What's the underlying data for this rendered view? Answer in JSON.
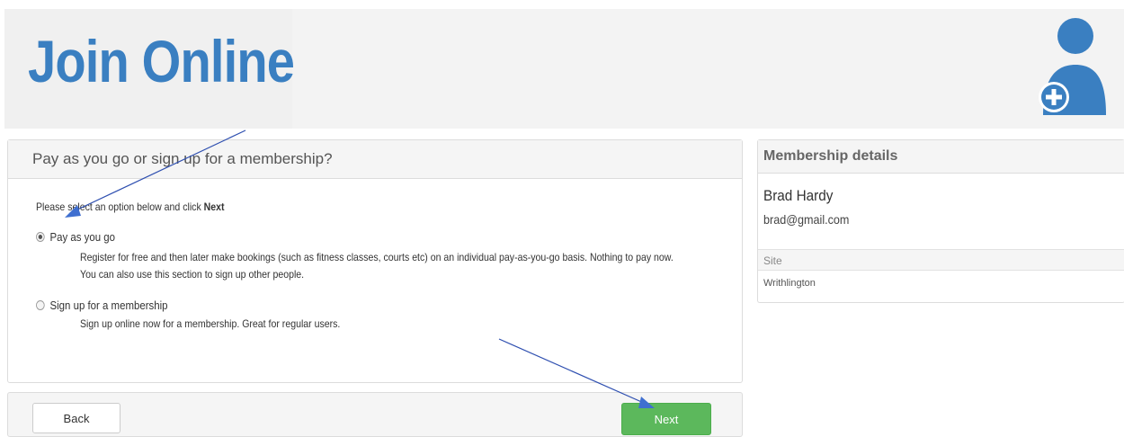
{
  "header": {
    "title": "Join Online",
    "icon": "add-user-icon",
    "accent_color": "#3a7fc1"
  },
  "choice": {
    "heading": "Pay as you go or sign up for a membership?",
    "prompt_text": "Please select an option below and click ",
    "prompt_bold": "Next",
    "options": [
      {
        "label": "Pay as you go",
        "selected": true,
        "description": "Register for free and then later make bookings (such as fitness classes, courts etc) on an individual pay-as-you-go basis. Nothing to pay now. You can also use this section to sign up other people."
      },
      {
        "label": "Sign up for a membership",
        "selected": false,
        "description": "Sign up online now for a membership. Great for regular users."
      }
    ]
  },
  "footer": {
    "back_label": "Back",
    "next_label": "Next",
    "next_color": "#5cb85c"
  },
  "details": {
    "heading": "Membership details",
    "name": "Brad Hardy",
    "email": "brad@gmail.com",
    "site_label": "Site",
    "site_value": "Writhlington"
  }
}
